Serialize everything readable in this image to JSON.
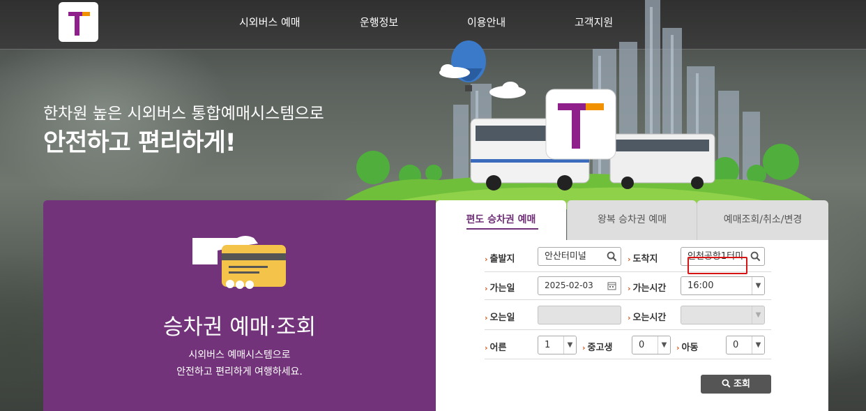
{
  "header": {
    "logo_alt": "T",
    "nav": [
      "시외버스 예매",
      "운행정보",
      "이용안내",
      "고객지원"
    ]
  },
  "hero": {
    "line1": "한차원 높은 시외버스 통합예매시스템으로",
    "line2": "안전하고 편리하게!"
  },
  "promo": {
    "title": "승차권 예매·조회",
    "desc_line1": "시외버스 예매시스템으로",
    "desc_line2": "안전하고 편리하게 여행하세요."
  },
  "tabs": [
    {
      "label": "편도 승차권 예매",
      "active": true
    },
    {
      "label": "왕복 승차권 예매",
      "active": false
    },
    {
      "label": "예매조회/취소/변경",
      "active": false
    }
  ],
  "form": {
    "departure_label": "출발지",
    "departure_value": "안산터미널",
    "arrival_label": "도착지",
    "arrival_value": "인천공항1터미",
    "go_date_label": "가는일",
    "go_date_value": "2025-02-03",
    "go_time_label": "가는시간",
    "go_time_value": "16:00",
    "return_date_label": "오는일",
    "return_date_value": "",
    "return_time_label": "오는시간",
    "return_time_value": "",
    "adult_label": "어른",
    "adult_value": "1",
    "youth_label": "중고생",
    "youth_value": "0",
    "child_label": "아동",
    "child_value": "0",
    "search_label": "조회"
  },
  "colors": {
    "brand_purple": "#73337a",
    "accent_orange": "#d25a1e",
    "highlight_red": "#d81313"
  }
}
